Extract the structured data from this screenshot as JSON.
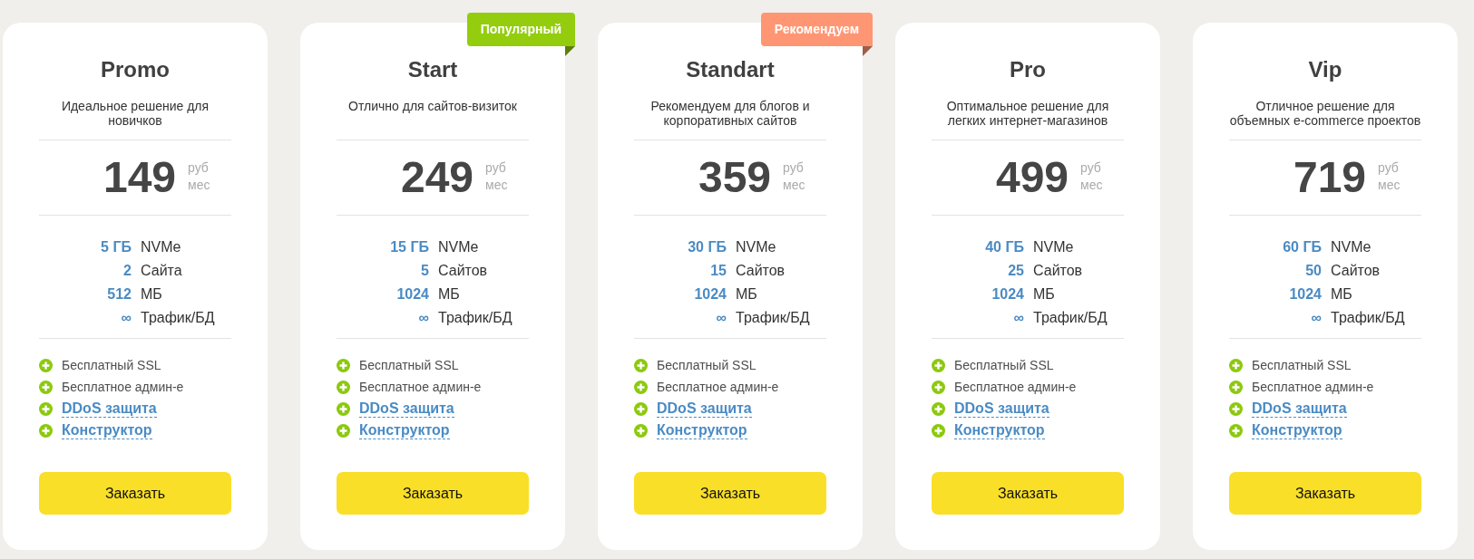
{
  "plans": [
    {
      "name": "Promo",
      "description": "Идеальное решение для новичков",
      "price": "149",
      "currency": "руб",
      "period": "мес",
      "specs": [
        {
          "amount": "5 ГБ",
          "unit": "NVMe"
        },
        {
          "amount": "2",
          "unit": "Сайта"
        },
        {
          "amount": "512",
          "unit": "МБ"
        },
        {
          "amount": "∞",
          "unit": "Трафик/БД"
        }
      ],
      "features": [
        {
          "kind": "text",
          "label": "Бесплатный SSL"
        },
        {
          "kind": "text",
          "label": "Бесплатное админ-е"
        },
        {
          "kind": "link",
          "label": "DDoS защита"
        },
        {
          "kind": "link",
          "label": "Конструктор"
        }
      ],
      "button": "Заказать"
    },
    {
      "name": "Start",
      "badge": {
        "text": "Популярный",
        "color": "#93cd0e"
      },
      "description": "Отлично для сайтов-визиток",
      "price": "249",
      "currency": "руб",
      "period": "мес",
      "specs": [
        {
          "amount": "15 ГБ",
          "unit": "NVMe"
        },
        {
          "amount": "5",
          "unit": "Сайтов"
        },
        {
          "amount": "1024",
          "unit": "МБ"
        },
        {
          "amount": "∞",
          "unit": "Трафик/БД"
        }
      ],
      "features": [
        {
          "kind": "text",
          "label": "Бесплатный SSL"
        },
        {
          "kind": "text",
          "label": "Бесплатное админ-е"
        },
        {
          "kind": "link",
          "label": "DDoS защита"
        },
        {
          "kind": "link",
          "label": "Конструктор"
        }
      ],
      "button": "Заказать"
    },
    {
      "name": "Standart",
      "badge": {
        "text": "Рекомендуем",
        "color": "#ff9673"
      },
      "description": "Рекомендуем для блогов и корпоративных сайтов",
      "price": "359",
      "currency": "руб",
      "period": "мес",
      "specs": [
        {
          "amount": "30 ГБ",
          "unit": "NVMe"
        },
        {
          "amount": "15",
          "unit": "Сайтов"
        },
        {
          "amount": "1024",
          "unit": "МБ"
        },
        {
          "amount": "∞",
          "unit": "Трафик/БД"
        }
      ],
      "features": [
        {
          "kind": "text",
          "label": "Бесплатный SSL"
        },
        {
          "kind": "text",
          "label": "Бесплатное админ-е"
        },
        {
          "kind": "link",
          "label": "DDoS защита"
        },
        {
          "kind": "link",
          "label": "Конструктор"
        }
      ],
      "button": "Заказать"
    },
    {
      "name": "Pro",
      "description": "Оптимальное решение для легких интернет-магазинов",
      "price": "499",
      "currency": "руб",
      "period": "мес",
      "specs": [
        {
          "amount": "40 ГБ",
          "unit": "NVMe"
        },
        {
          "amount": "25",
          "unit": "Сайтов"
        },
        {
          "amount": "1024",
          "unit": "МБ"
        },
        {
          "amount": "∞",
          "unit": "Трафик/БД"
        }
      ],
      "features": [
        {
          "kind": "text",
          "label": "Бесплатный SSL"
        },
        {
          "kind": "text",
          "label": "Бесплатное админ-е"
        },
        {
          "kind": "link",
          "label": "DDoS защита"
        },
        {
          "kind": "link",
          "label": "Конструктор"
        }
      ],
      "button": "Заказать"
    },
    {
      "name": "Vip",
      "description": "Отличное решение для объемных e-commerce проектов",
      "price": "719",
      "currency": "руб",
      "period": "мес",
      "specs": [
        {
          "amount": "60 ГБ",
          "unit": "NVMe"
        },
        {
          "amount": "50",
          "unit": "Сайтов"
        },
        {
          "amount": "1024",
          "unit": "МБ"
        },
        {
          "amount": "∞",
          "unit": "Трафик/БД"
        }
      ],
      "features": [
        {
          "kind": "text",
          "label": "Бесплатный SSL"
        },
        {
          "kind": "text",
          "label": "Бесплатное админ-е"
        },
        {
          "kind": "link",
          "label": "DDoS защита"
        },
        {
          "kind": "link",
          "label": "Конструктор"
        }
      ],
      "button": "Заказать"
    }
  ]
}
